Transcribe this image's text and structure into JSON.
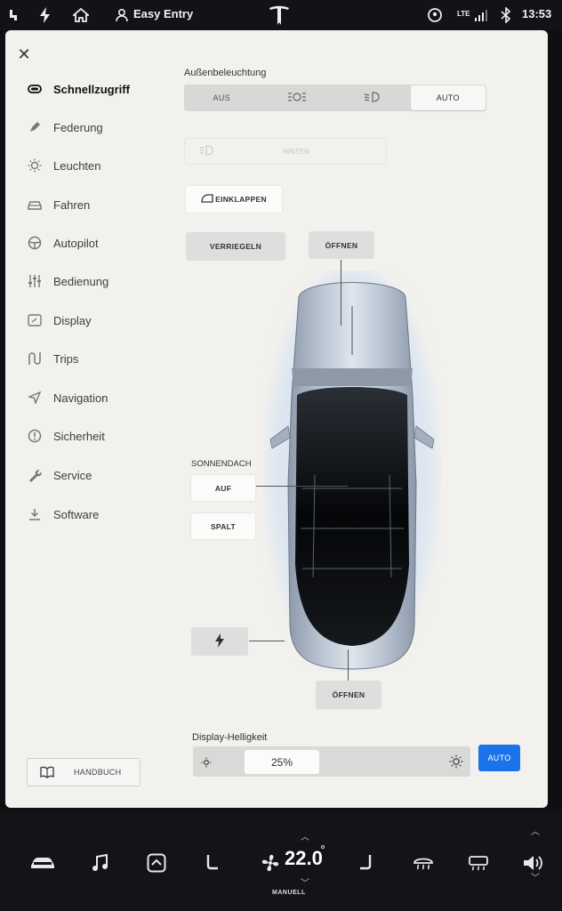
{
  "statusbar": {
    "profile_label": "Easy Entry",
    "network": "LTE",
    "time": "13:53"
  },
  "sidebar": {
    "items": [
      {
        "label": "Schnellzugriff",
        "icon": "car-front-icon",
        "active": true
      },
      {
        "label": "Federung",
        "icon": "pen-icon",
        "active": false
      },
      {
        "label": "Leuchten",
        "icon": "sun-icon",
        "active": false
      },
      {
        "label": "Fahren",
        "icon": "car-icon",
        "active": false
      },
      {
        "label": "Autopilot",
        "icon": "steering-wheel-icon",
        "active": false
      },
      {
        "label": "Bedienung",
        "icon": "sliders-icon",
        "active": false
      },
      {
        "label": "Display",
        "icon": "display-icon",
        "active": false
      },
      {
        "label": "Trips",
        "icon": "trips-icon",
        "active": false
      },
      {
        "label": "Navigation",
        "icon": "navigation-arrow-icon",
        "active": false
      },
      {
        "label": "Sicherheit",
        "icon": "alert-circle-icon",
        "active": false
      },
      {
        "label": "Service",
        "icon": "wrench-icon",
        "active": false
      },
      {
        "label": "Software",
        "icon": "download-icon",
        "active": false
      }
    ],
    "manual_label": "HANDBUCH"
  },
  "lighting": {
    "title": "Außenbeleuchtung",
    "options": [
      "AUS",
      "",
      "",
      "AUTO"
    ],
    "selected": "AUTO",
    "rear_fog_label": "HINTEN"
  },
  "mirrors": {
    "fold_label": "EINKLAPPEN"
  },
  "locks": {
    "lock_label": "VERRIEGELN",
    "frunk_label": "ÖFFNEN",
    "trunk_label": "ÖFFNEN"
  },
  "sunroof": {
    "title": "SONNENDACH",
    "open_label": "AUF",
    "vent_label": "SPALT"
  },
  "brightness": {
    "title": "Display-Helligkeit",
    "value": "25%",
    "level": 0.25,
    "auto_label": "AUTO"
  },
  "dock": {
    "temperature": "22.0",
    "fan_mode": "MANUELL"
  },
  "colors": {
    "accent": "#1a73e8",
    "panel": "#f2f1ee",
    "dock": "#131418"
  }
}
